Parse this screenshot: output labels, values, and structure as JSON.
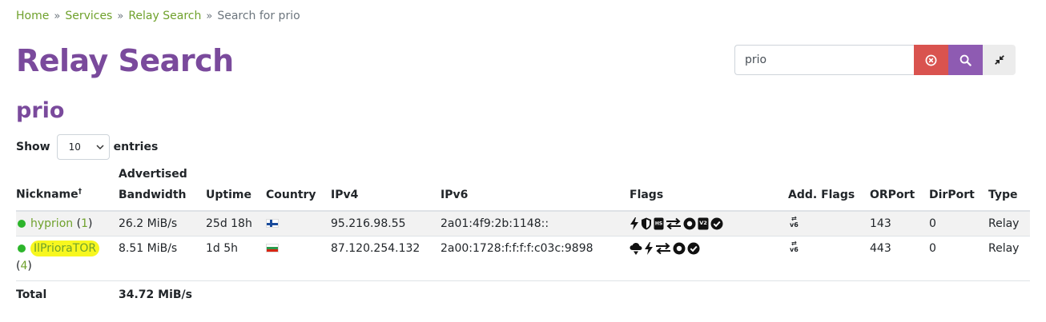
{
  "breadcrumb": {
    "items": [
      "Home",
      "Services",
      "Relay Search"
    ],
    "current": "Search for prio",
    "separator": "»"
  },
  "page_title": "Relay Search",
  "query_title": "prio",
  "search": {
    "value": "prio"
  },
  "length": {
    "label_before": "Show",
    "selected": "10",
    "label_after": "entries"
  },
  "table": {
    "headers": {
      "nickname": "Nickname",
      "nickname_sup": "†",
      "bandwidth_line1": "Advertised",
      "bandwidth_line2": "Bandwidth",
      "uptime": "Uptime",
      "country": "Country",
      "ipv4": "IPv4",
      "ipv6": "IPv6",
      "flags": "Flags",
      "add_flags": "Add. Flags",
      "orport": "ORPort",
      "dirport": "DirPort",
      "type": "Type"
    },
    "rows": [
      {
        "nickname": "hyprion",
        "family_open": "(",
        "family_count": "1",
        "family_close": ")",
        "bandwidth": "26.2 MiB/s",
        "uptime": "25d 18h",
        "country": "fi",
        "ipv4": "95.216.98.55",
        "ipv6": "2a01:4f9:2b:1148::",
        "flags": [
          "fast-icon",
          "guard-icon",
          "hsdir-icon",
          "stable-icon",
          "running-icon",
          "v2dir-icon",
          "valid-icon"
        ],
        "orport": "143",
        "dirport": "0",
        "type": "Relay"
      },
      {
        "nickname": "IlPrioraTOR",
        "family_open": "(",
        "family_count": "4",
        "family_close": ")",
        "bandwidth": "8.51 MiB/s",
        "uptime": "1d 5h",
        "country": "bg",
        "ipv4": "87.120.254.132",
        "ipv6": "2a00:1728:f:f:f:f:c03c:9898",
        "flags": [
          "exit-icon",
          "fast-icon",
          "stable-icon",
          "running-icon",
          "valid-icon"
        ],
        "orport": "443",
        "dirport": "0",
        "type": "Relay"
      }
    ],
    "total": {
      "label": "Total",
      "bandwidth": "34.72 MiB/s"
    }
  },
  "add_flag_label": {
    "top": "⇄",
    "bottom": "v6"
  }
}
